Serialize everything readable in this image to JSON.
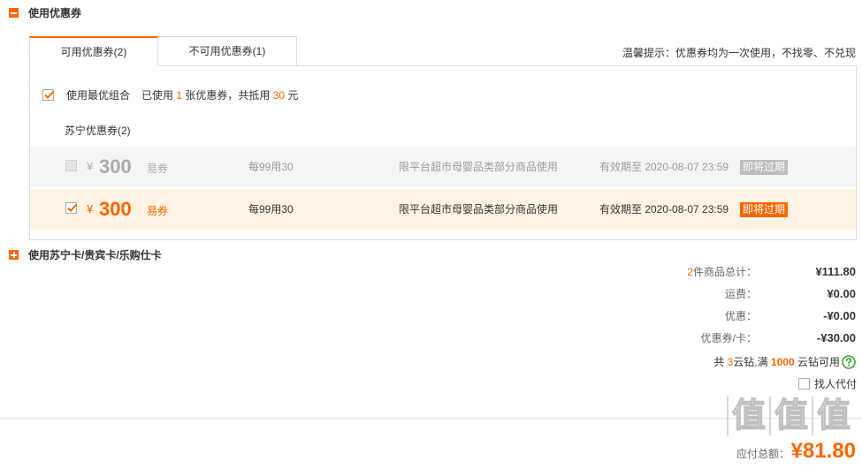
{
  "coupon_section": {
    "title": "使用优惠券",
    "tabs": [
      {
        "label": "可用优惠券(2)",
        "active": true
      },
      {
        "label": "不可用优惠券(1)",
        "active": false
      }
    ],
    "tip": "温馨提示：优惠券均为一次使用，不找零、不兑现",
    "best_combo": {
      "label": "使用最优组合",
      "checked": true
    },
    "applied": {
      "prefix": "已使用 ",
      "count": "1",
      "middle": " 张优惠券，共抵用 ",
      "amount": "30",
      "suffix": " 元"
    },
    "group_title": "苏宁优惠券(2)",
    "coupons": [
      {
        "checked": false,
        "currency": "¥",
        "amount": "300",
        "type": "易券",
        "rule": "每99用30",
        "scope": "限平台超市母婴品类部分商品使用",
        "validity": "有效期至 2020-08-07 23:59",
        "badge": "即将过期"
      },
      {
        "checked": true,
        "currency": "¥",
        "amount": "300",
        "type": "易券",
        "rule": "每99用30",
        "scope": "限平台超市母婴品类部分商品使用",
        "validity": "有效期至 2020-08-07 23:59",
        "badge": "即将过期"
      }
    ]
  },
  "card_section": {
    "title": "使用苏宁卡/贵宾卡/乐购仕卡"
  },
  "totals": {
    "goods": {
      "count": "2",
      "label": "件商品总计：",
      "value": "¥111.80"
    },
    "shipping": {
      "label": "运费：",
      "value": "¥0.00"
    },
    "discount": {
      "label": "优惠：",
      "value": "-¥0.00"
    },
    "coupon_card": {
      "label": "优惠券/卡：",
      "value": "-¥30.00"
    },
    "cloud_diamond": {
      "prefix": "共 ",
      "count": "3",
      "middle": "云钻,满 ",
      "threshold": "1000",
      "suffix": " 云钻可用"
    },
    "pay_for_me": {
      "label": "找人代付",
      "checked": false
    },
    "payable": {
      "label": "应付总额：",
      "value": "¥81.80"
    }
  },
  "watermark": {
    "glyphs": [
      "值",
      "值",
      "值"
    ]
  },
  "icons": {
    "coupon_section_toggle": "minus-square-icon",
    "card_section_toggle": "plus-square-icon",
    "checkbox_mark": "check-icon",
    "cloud_diamond_help": "question-circle-icon"
  },
  "colors": {
    "accent": "#ff6600",
    "selected_row_bg": "#fff3e3",
    "muted_row_bg": "#f5f5f5",
    "muted_badge": "#bdbdbd",
    "help_green": "#3aa935",
    "border": "#dddddd"
  }
}
